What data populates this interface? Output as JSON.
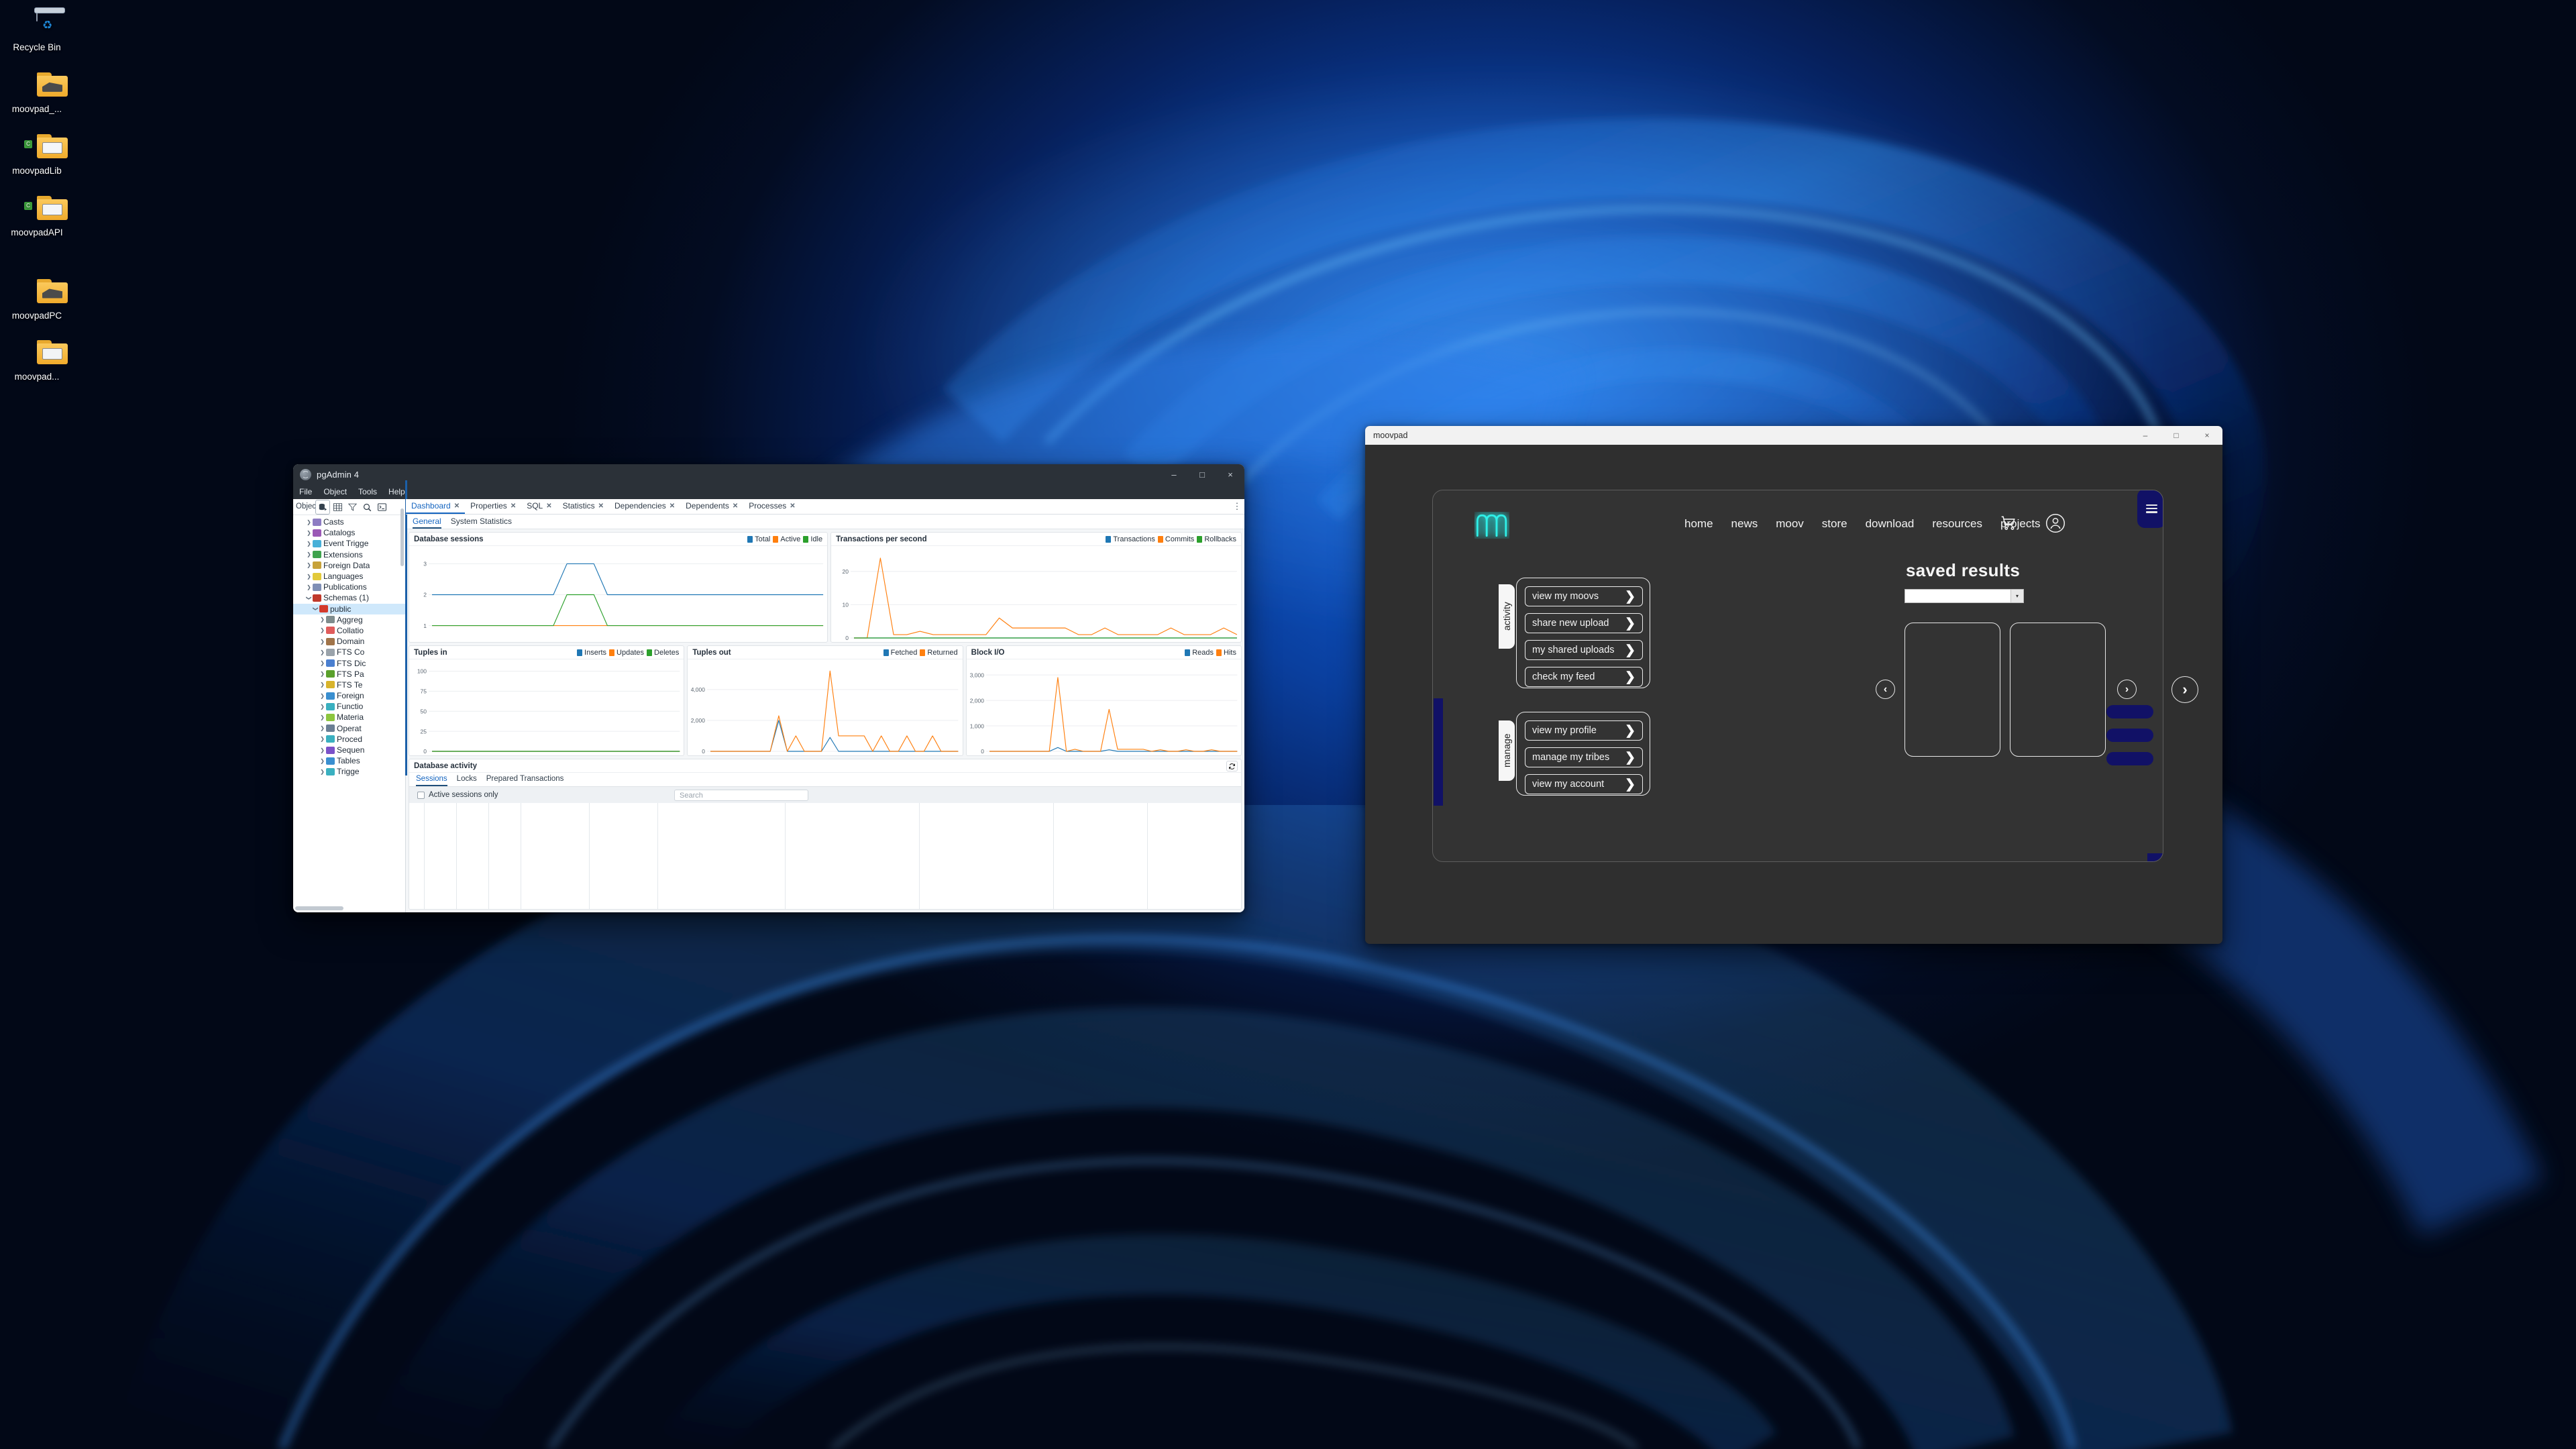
{
  "desktop": {
    "icons": [
      {
        "name": "Recycle Bin",
        "type": "recycle-bin"
      },
      {
        "name": "moovpad_...",
        "type": "folder-archive"
      },
      {
        "name": "moovpadLib",
        "type": "folder-csharp"
      },
      {
        "name": "moovpadAPI",
        "type": "folder-csharp"
      },
      {
        "name": "moovpadPC",
        "type": "folder-archive"
      },
      {
        "name": "moovpad...",
        "type": "folder-doc"
      }
    ]
  },
  "pgadmin": {
    "title": "pgAdmin 4",
    "window_buttons": {
      "minimize": "–",
      "maximize": "□",
      "close": "×"
    },
    "menus": [
      "File",
      "Object",
      "Tools",
      "Help"
    ],
    "object_explorer": {
      "label": "Object",
      "toolbar_icons": [
        "database-icon",
        "table-grid-icon",
        "filter-icon",
        "search-icon",
        "terminal-icon"
      ],
      "tree": [
        {
          "label": "Casts",
          "indent": 1,
          "expanded": false,
          "color": "#8e7cc3"
        },
        {
          "label": "Catalogs",
          "indent": 1,
          "expanded": false,
          "color": "#9b59b6"
        },
        {
          "label": "Event Trigge",
          "indent": 1,
          "expanded": false,
          "color": "#48b0d8"
        },
        {
          "label": "Extensions",
          "indent": 1,
          "expanded": false,
          "color": "#3fa34d"
        },
        {
          "label": "Foreign Data",
          "indent": 1,
          "expanded": false,
          "color": "#c7a23a"
        },
        {
          "label": "Languages",
          "indent": 1,
          "expanded": false,
          "color": "#e2c93a"
        },
        {
          "label": "Publications",
          "indent": 1,
          "expanded": false,
          "color": "#7f8fb5"
        },
        {
          "label": "Schemas (1)",
          "indent": 1,
          "expanded": true,
          "color": "#c0392b"
        },
        {
          "label": "public",
          "indent": 2,
          "expanded": true,
          "selected": true,
          "color": "#d33a2c"
        },
        {
          "label": "Aggreg",
          "indent": 3,
          "expanded": false,
          "color": "#7f8c8d"
        },
        {
          "label": "Collatio",
          "indent": 3,
          "expanded": false,
          "color": "#e05c5c"
        },
        {
          "label": "Domain",
          "indent": 3,
          "expanded": false,
          "color": "#a0744a"
        },
        {
          "label": "FTS Co",
          "indent": 3,
          "expanded": false,
          "color": "#9aa3ab"
        },
        {
          "label": "FTS Dic",
          "indent": 3,
          "expanded": false,
          "color": "#4a7fd0"
        },
        {
          "label": "FTS Pa",
          "indent": 3,
          "expanded": false,
          "color": "#5aa02c"
        },
        {
          "label": "FTS Te",
          "indent": 3,
          "expanded": false,
          "color": "#d8b42c"
        },
        {
          "label": "Foreign",
          "indent": 3,
          "expanded": false,
          "color": "#3a8fd0"
        },
        {
          "label": "Functio",
          "indent": 3,
          "expanded": false,
          "color": "#3ab0c0"
        },
        {
          "label": "Materia",
          "indent": 3,
          "expanded": false,
          "color": "#8cc63f"
        },
        {
          "label": "Operat",
          "indent": 3,
          "expanded": false,
          "color": "#6b7f94"
        },
        {
          "label": "Proced",
          "indent": 3,
          "expanded": false,
          "color": "#3ab0c0"
        },
        {
          "label": "Sequen",
          "indent": 3,
          "expanded": false,
          "color": "#7b52c9"
        },
        {
          "label": "Tables",
          "indent": 3,
          "expanded": false,
          "color": "#3a8fd0"
        },
        {
          "label": "Trigge",
          "indent": 3,
          "expanded": false,
          "color": "#3ab0c0"
        }
      ]
    },
    "tabs": [
      {
        "label": "Dashboard",
        "active": true,
        "closable": true
      },
      {
        "label": "Properties",
        "active": false,
        "closable": true
      },
      {
        "label": "SQL",
        "active": false,
        "closable": true
      },
      {
        "label": "Statistics",
        "active": false,
        "closable": true
      },
      {
        "label": "Dependencies",
        "active": false,
        "closable": true
      },
      {
        "label": "Dependents",
        "active": false,
        "closable": true
      },
      {
        "label": "Processes",
        "active": false,
        "closable": true
      }
    ],
    "tabs_overflow_icon": "kebab-menu-icon",
    "subtabs": [
      {
        "label": "General",
        "active": true
      },
      {
        "label": "System Statistics",
        "active": false
      }
    ],
    "activity": {
      "title": "Database activity",
      "refresh_icon": "refresh-icon",
      "tabs": [
        {
          "label": "Sessions",
          "active": true
        },
        {
          "label": "Locks",
          "active": false
        },
        {
          "label": "Prepared Transactions",
          "active": false
        }
      ],
      "checkbox_label": "Active sessions only",
      "checkbox_checked": false,
      "search_placeholder": "Search"
    }
  },
  "chart_data": [
    {
      "id": "database-sessions",
      "type": "line",
      "title": "Database sessions",
      "legend": [
        {
          "name": "Total",
          "color": "#1f77b4"
        },
        {
          "name": "Active",
          "color": "#ff7f0e"
        },
        {
          "name": "Idle",
          "color": "#2ca02c"
        }
      ],
      "ylim": [
        0.6,
        3.4
      ],
      "yticks": [
        1,
        2,
        3
      ],
      "grid": true,
      "legend_position": "top-right",
      "x": [
        0,
        1,
        2,
        3,
        4,
        5,
        6,
        7,
        8,
        9,
        10,
        11,
        12,
        13,
        14,
        15,
        16,
        17,
        18,
        19,
        20,
        21,
        22,
        23,
        24,
        25,
        26,
        27,
        28,
        29
      ],
      "series": [
        {
          "name": "Total",
          "color": "#1f77b4",
          "values": [
            2,
            2,
            2,
            2,
            2,
            2,
            2,
            2,
            2,
            2,
            3,
            3,
            3,
            2,
            2,
            2,
            2,
            2,
            2,
            2,
            2,
            2,
            2,
            2,
            2,
            2,
            2,
            2,
            2,
            2
          ]
        },
        {
          "name": "Active",
          "color": "#ff7f0e",
          "values": [
            1,
            1,
            1,
            1,
            1,
            1,
            1,
            1,
            1,
            1,
            1,
            1,
            1,
            1,
            1,
            1,
            1,
            1,
            1,
            1,
            1,
            1,
            1,
            1,
            1,
            1,
            1,
            1,
            1,
            1
          ]
        },
        {
          "name": "Idle",
          "color": "#2ca02c",
          "values": [
            1,
            1,
            1,
            1,
            1,
            1,
            1,
            1,
            1,
            1,
            2,
            2,
            2,
            1,
            1,
            1,
            1,
            1,
            1,
            1,
            1,
            1,
            1,
            1,
            1,
            1,
            1,
            1,
            1,
            1
          ]
        }
      ]
    },
    {
      "id": "transactions-per-second",
      "type": "line",
      "title": "Transactions per second",
      "legend": [
        {
          "name": "Transactions",
          "color": "#1f77b4"
        },
        {
          "name": "Commits",
          "color": "#ff7f0e"
        },
        {
          "name": "Rollbacks",
          "color": "#2ca02c"
        }
      ],
      "ylim": [
        0,
        26
      ],
      "yticks": [
        0,
        10,
        20
      ],
      "grid": true,
      "legend_position": "top-right",
      "x": [
        0,
        1,
        2,
        3,
        4,
        5,
        6,
        7,
        8,
        9,
        10,
        11,
        12,
        13,
        14,
        15,
        16,
        17,
        18,
        19,
        20,
        21,
        22,
        23,
        24,
        25,
        26,
        27,
        28,
        29
      ],
      "series": [
        {
          "name": "Transactions",
          "color": "#1f77b4",
          "values": [
            0,
            0,
            0,
            0,
            0,
            0,
            0,
            0,
            0,
            0,
            0,
            0,
            0,
            0,
            0,
            0,
            0,
            0,
            0,
            0,
            0,
            0,
            0,
            0,
            0,
            0,
            0,
            0,
            0,
            0
          ]
        },
        {
          "name": "Commits",
          "color": "#ff7f0e",
          "values": [
            0,
            0,
            24,
            1,
            1,
            2,
            1,
            1,
            1,
            1,
            1,
            6,
            3,
            3,
            3,
            3,
            3,
            1,
            1,
            3,
            1,
            1,
            1,
            1,
            3,
            1,
            1,
            1,
            3,
            1
          ]
        },
        {
          "name": "Rollbacks",
          "color": "#2ca02c",
          "values": [
            0,
            0,
            0,
            0,
            0,
            0,
            0,
            0,
            0,
            0,
            0,
            0,
            0,
            0,
            0,
            0,
            0,
            0,
            0,
            0,
            0,
            0,
            0,
            0,
            0,
            0,
            0,
            0,
            0,
            0
          ]
        }
      ]
    },
    {
      "id": "tuples-in",
      "type": "line",
      "title": "Tuples in",
      "legend": [
        {
          "name": "Inserts",
          "color": "#1f77b4"
        },
        {
          "name": "Updates",
          "color": "#ff7f0e"
        },
        {
          "name": "Deletes",
          "color": "#2ca02c"
        }
      ],
      "ylim": [
        0,
        108
      ],
      "yticks": [
        0,
        25,
        50,
        75,
        100
      ],
      "grid": true,
      "legend_position": "top-right",
      "x": [
        0,
        1,
        2,
        3,
        4,
        5,
        6,
        7,
        8,
        9,
        10,
        11,
        12,
        13,
        14,
        15,
        16,
        17,
        18,
        19,
        20,
        21,
        22,
        23,
        24,
        25,
        26,
        27,
        28,
        29
      ],
      "series": [
        {
          "name": "Inserts",
          "color": "#1f77b4",
          "values": [
            0,
            0,
            0,
            0,
            0,
            0,
            0,
            0,
            0,
            0,
            0,
            0,
            0,
            0,
            0,
            0,
            0,
            0,
            0,
            0,
            0,
            0,
            0,
            0,
            0,
            0,
            0,
            0,
            0,
            0
          ]
        },
        {
          "name": "Updates",
          "color": "#ff7f0e",
          "values": [
            0,
            0,
            0,
            0,
            0,
            0,
            0,
            0,
            0,
            0,
            0,
            0,
            0,
            0,
            0,
            0,
            0,
            0,
            0,
            0,
            0,
            0,
            0,
            0,
            0,
            0,
            0,
            0,
            0,
            0
          ]
        },
        {
          "name": "Deletes",
          "color": "#2ca02c",
          "values": [
            0,
            0,
            0,
            0,
            0,
            0,
            0,
            0,
            0,
            0,
            0,
            0,
            0,
            0,
            0,
            0,
            0,
            0,
            0,
            0,
            0,
            0,
            0,
            0,
            0,
            0,
            0,
            0,
            0,
            0
          ]
        }
      ]
    },
    {
      "id": "tuples-out",
      "type": "line",
      "title": "Tuples out",
      "legend": [
        {
          "name": "Fetched",
          "color": "#1f77b4"
        },
        {
          "name": "Returned",
          "color": "#ff7f0e"
        }
      ],
      "ylim": [
        0,
        5600
      ],
      "yticks": [
        0,
        2000,
        4000
      ],
      "grid": true,
      "legend_position": "top-right",
      "x": [
        0,
        1,
        2,
        3,
        4,
        5,
        6,
        7,
        8,
        9,
        10,
        11,
        12,
        13,
        14,
        15,
        16,
        17,
        18,
        19,
        20,
        21,
        22,
        23,
        24,
        25,
        26,
        27,
        28,
        29
      ],
      "series": [
        {
          "name": "Fetched",
          "color": "#1f77b4",
          "values": [
            0,
            0,
            0,
            0,
            0,
            0,
            0,
            0,
            2000,
            0,
            0,
            0,
            0,
            0,
            900,
            0,
            0,
            0,
            0,
            0,
            0,
            0,
            0,
            0,
            0,
            0,
            0,
            0,
            0,
            0
          ]
        },
        {
          "name": "Returned",
          "color": "#ff7f0e",
          "values": [
            0,
            0,
            0,
            0,
            0,
            0,
            0,
            0,
            2300,
            0,
            1000,
            0,
            0,
            0,
            5200,
            1000,
            1000,
            1000,
            1000,
            0,
            1000,
            0,
            0,
            1000,
            0,
            0,
            1000,
            0,
            0,
            0
          ]
        }
      ]
    },
    {
      "id": "block-io",
      "type": "line",
      "title": "Block I/O",
      "legend": [
        {
          "name": "Reads",
          "color": "#1f77b4"
        },
        {
          "name": "Hits",
          "color": "#ff7f0e"
        }
      ],
      "ylim": [
        0,
        3400
      ],
      "yticks": [
        0,
        1000,
        2000,
        3000
      ],
      "grid": true,
      "legend_position": "top-right",
      "x": [
        0,
        1,
        2,
        3,
        4,
        5,
        6,
        7,
        8,
        9,
        10,
        11,
        12,
        13,
        14,
        15,
        16,
        17,
        18,
        19,
        20,
        21,
        22,
        23,
        24,
        25,
        26,
        27,
        28,
        29
      ],
      "series": [
        {
          "name": "Reads",
          "color": "#1f77b4",
          "values": [
            0,
            0,
            0,
            0,
            0,
            0,
            0,
            0,
            150,
            0,
            0,
            0,
            0,
            0,
            60,
            0,
            0,
            0,
            0,
            0,
            0,
            0,
            0,
            0,
            0,
            0,
            0,
            0,
            0,
            0
          ]
        },
        {
          "name": "Hits",
          "color": "#ff7f0e",
          "values": [
            0,
            0,
            0,
            0,
            0,
            0,
            0,
            0,
            2900,
            0,
            80,
            0,
            0,
            0,
            1650,
            80,
            80,
            80,
            80,
            0,
            60,
            0,
            0,
            60,
            0,
            0,
            60,
            0,
            0,
            0
          ]
        }
      ]
    }
  ],
  "moovpad": {
    "title": "moovpad",
    "window_buttons": {
      "minimize": "–",
      "maximize": "□",
      "close": "×"
    },
    "logo_icon": "moovpad-m-logo",
    "logo_color": "#2ff0e8",
    "nav": [
      "home",
      "news",
      "moov",
      "store",
      "download",
      "resources",
      "projects"
    ],
    "cart_icon": "shopping-cart-icon",
    "account_icon": "user-account-icon",
    "menu_icon": "hamburger-menu-icon",
    "accent_color": "#111166",
    "panels": [
      {
        "tab_label": "activity",
        "buttons": [
          {
            "label": "view my moovs",
            "chevron": "›"
          },
          {
            "label": "share new upload",
            "chevron": "›"
          },
          {
            "label": "my shared uploads",
            "chevron": "›"
          },
          {
            "label": "check my feed",
            "chevron": "›"
          }
        ]
      },
      {
        "tab_label": "manage",
        "buttons": [
          {
            "label": "view my profile",
            "chevron": "›"
          },
          {
            "label": "manage my tribes",
            "chevron": "›"
          },
          {
            "label": "view my account",
            "chevron": "›"
          }
        ]
      }
    ],
    "saved_results": {
      "title": "saved results",
      "select_value": "",
      "select_arrow": "▾",
      "prev_icon": "‹",
      "next_icon": "›",
      "outer_next_icon": "›",
      "cards": 2
    },
    "pill_count": 3
  }
}
